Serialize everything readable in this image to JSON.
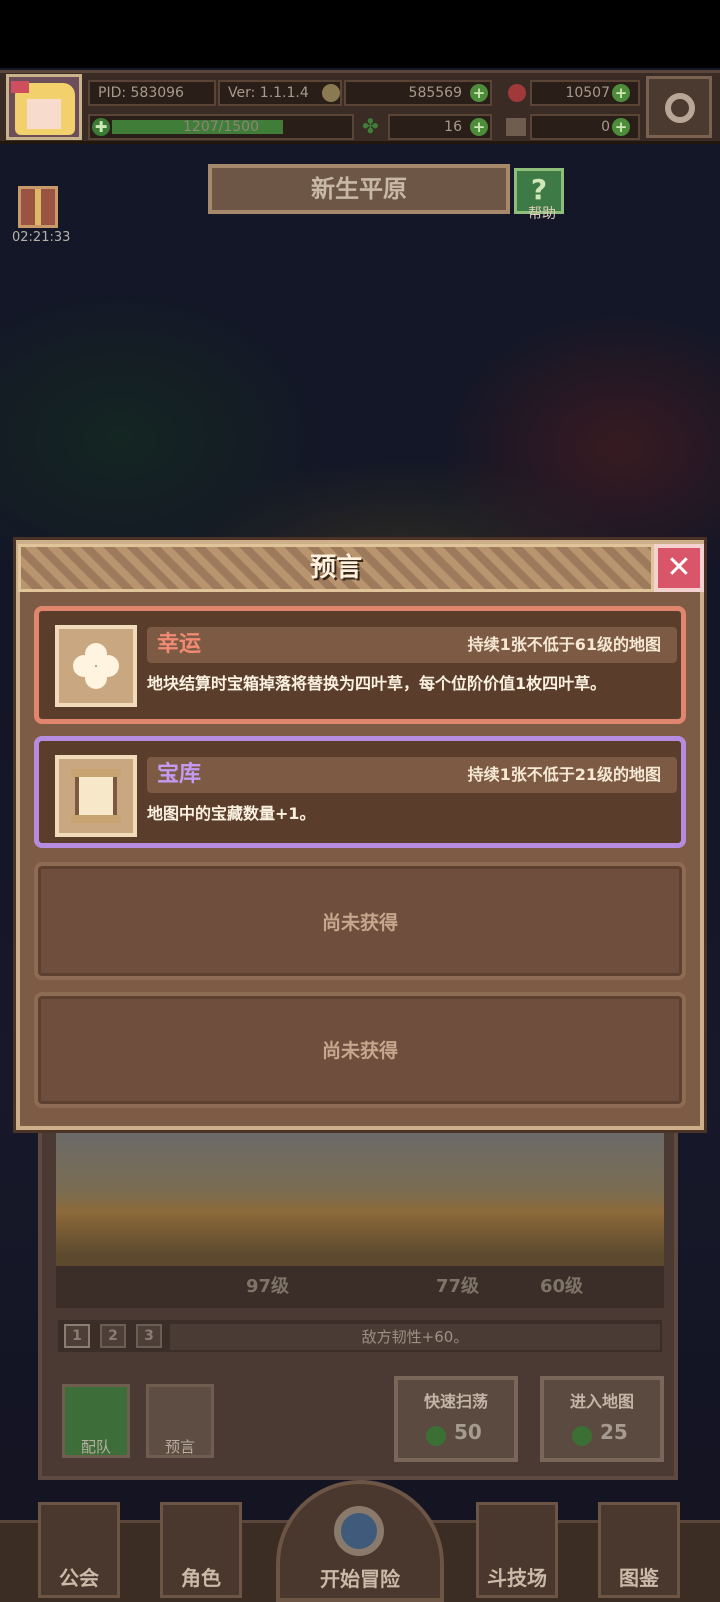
{
  "status": {
    "pid": "PID: 583096",
    "version": "Ver: 1.1.1.4",
    "gold": "585569",
    "gems": "10507",
    "energy_text": "1207/1500",
    "energy_fraction": 0.805,
    "clover": "16",
    "keys": "0"
  },
  "area": {
    "title": "新生平原",
    "help_label": "帮助",
    "gift_timer": "02:21:33"
  },
  "modal": {
    "title": "预言",
    "close_icon": "close-icon",
    "cards": [
      {
        "name": "幸运",
        "duration": "持续1张不低于61级的地图",
        "description": "地块结算时宝箱掉落将替换为四叶草，每个位阶价值1枚四叶草。",
        "icon": "clover-icon",
        "name_color": "#f08a73",
        "border_color": "#e0866e"
      },
      {
        "name": "宝库",
        "duration": "持续1张不低于21级的地图",
        "description": "地图中的宝藏数量+1。",
        "icon": "scroll-icon",
        "name_color": "#c49bf0",
        "border_color": "#b68ce0"
      }
    ],
    "empty_slots": [
      "尚未获得",
      "尚未获得"
    ]
  },
  "team": {
    "levels": [
      "97级",
      "77级",
      "60级"
    ],
    "tabs": [
      "1",
      "2",
      "3"
    ],
    "enemy_effect": "敌方韧性+60。",
    "formation_label": "配队",
    "prophecy_label": "预言",
    "quick_sweep": {
      "label": "快速扫荡",
      "cost": "50"
    },
    "enter_map": {
      "label": "进入地图",
      "cost": "25"
    }
  },
  "nav": {
    "guild": "公会",
    "character": "角色",
    "start": "开始冒险",
    "arena": "斗技场",
    "codex": "图鉴"
  },
  "colors": {
    "accent_green": "#4d8c3b",
    "close_red": "#d9566a"
  }
}
